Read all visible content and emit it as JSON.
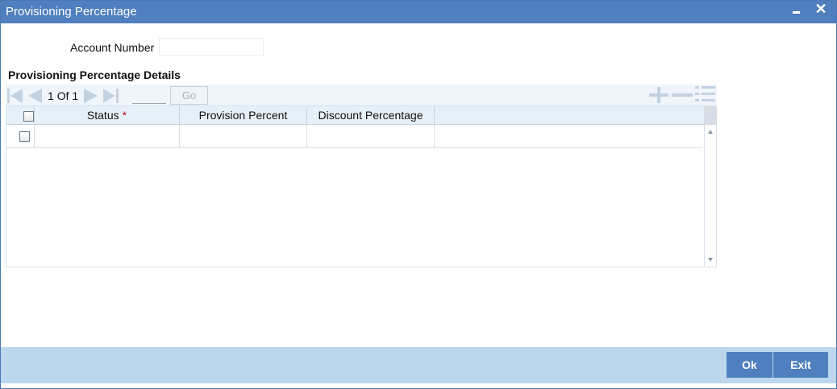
{
  "window": {
    "title": "Provisioning Percentage",
    "close_glyph": "✕"
  },
  "form": {
    "account_number_label": "Account Number",
    "account_number_value": ""
  },
  "section": {
    "title": "Provisioning Percentage Details"
  },
  "pager": {
    "current": "1",
    "of_label": "Of",
    "total": "1",
    "page_input_value": "",
    "go_label": "Go"
  },
  "grid": {
    "columns": [
      {
        "label": "Status",
        "required": true
      },
      {
        "label": "Provision Percent",
        "required": false
      },
      {
        "label": "Discount Percentage",
        "required": false
      }
    ],
    "required_marker": "*",
    "rows": [
      {
        "status": "",
        "provision_percent": "",
        "discount_percentage": ""
      }
    ]
  },
  "footer": {
    "ok_label": "Ok",
    "exit_label": "Exit"
  },
  "colors": {
    "titlebar": "#4f7fbe",
    "footer": "#bcd7ed",
    "button": "#4f7fbe",
    "toolbar": "#eff5fb",
    "grid_header": "#e6f0f9",
    "required": "#c8102e"
  },
  "icons": {
    "first": "first-page-icon",
    "prev": "previous-page-icon",
    "next": "next-page-icon",
    "last": "last-page-icon",
    "add": "add-row-icon",
    "delete": "delete-row-icon",
    "single_view": "single-record-view-icon"
  }
}
